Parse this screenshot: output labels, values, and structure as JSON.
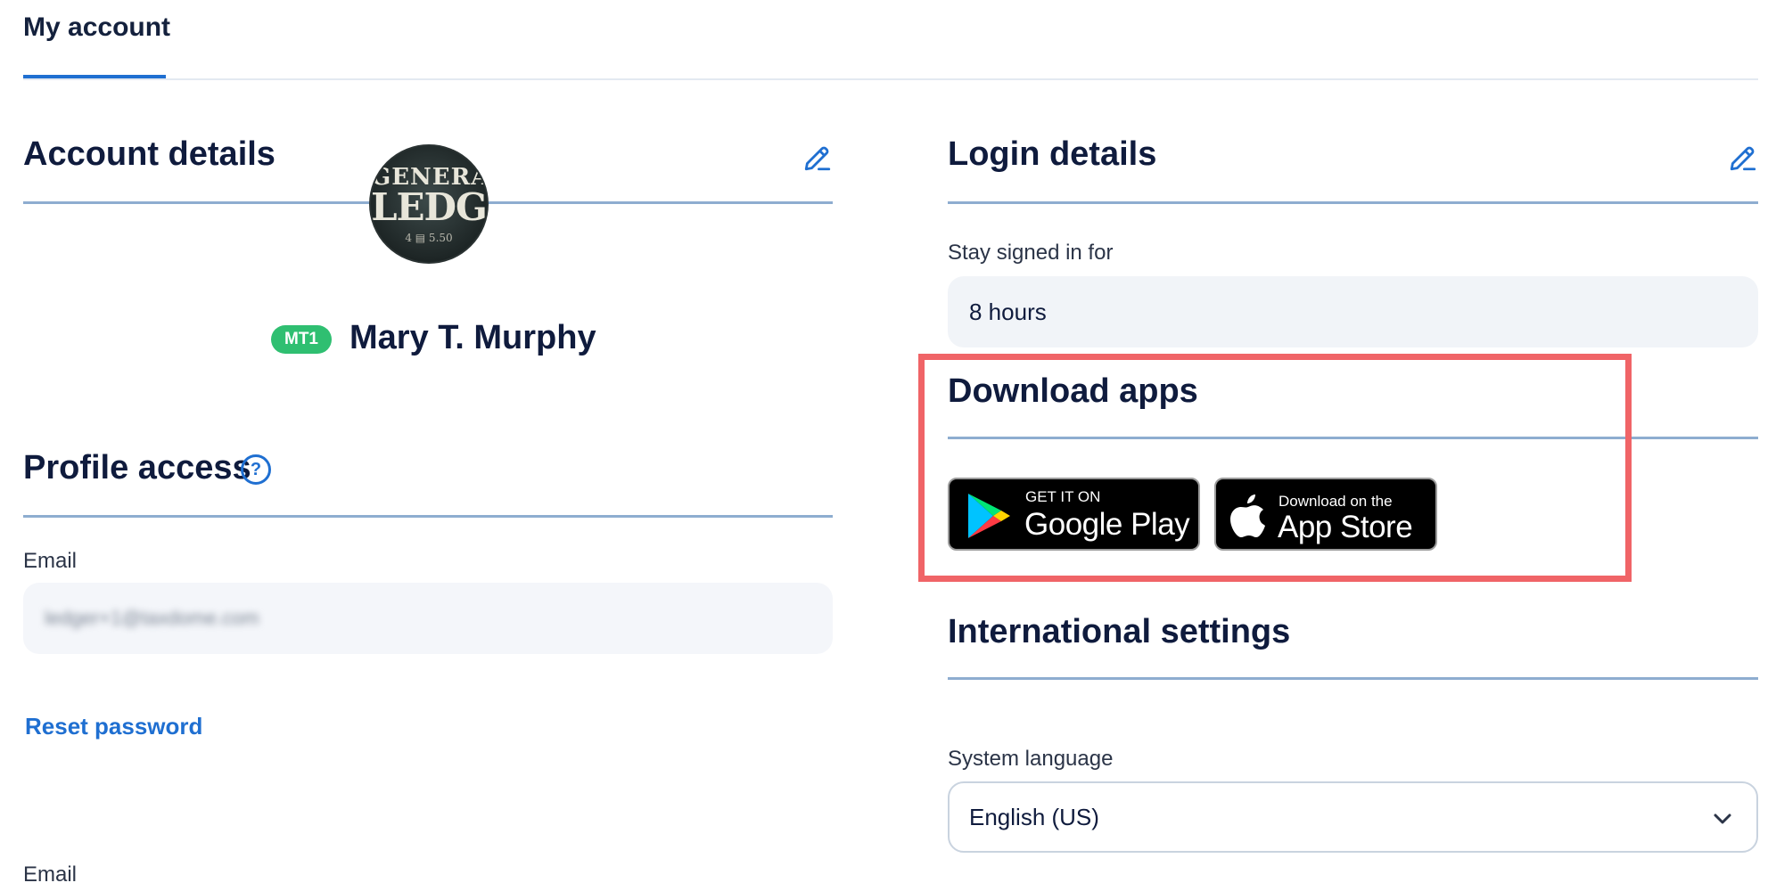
{
  "tabs": [
    {
      "label": "My account",
      "active": true
    }
  ],
  "account_details": {
    "title": "Account details",
    "avatar": {
      "line1": "GENERAL",
      "line2": "LEDGER",
      "line3": "4 ▤ 5.50"
    },
    "badge": "MT1",
    "name": "Mary T. Murphy"
  },
  "profile_access": {
    "title": "Profile access",
    "email_label": "Email",
    "email_value": "ledger+1@taxdome.com",
    "reset_password": "Reset password",
    "email_label_2": "Email"
  },
  "login_details": {
    "title": "Login details",
    "stay_signed_label": "Stay signed in for",
    "stay_signed_value": "8 hours"
  },
  "download_apps": {
    "title": "Download apps",
    "google_play": {
      "small": "GET IT ON",
      "big": "Google Play"
    },
    "app_store": {
      "small": "Download on the",
      "big": "App Store"
    }
  },
  "international": {
    "title": "International settings",
    "language_label": "System language",
    "language_value": "English (US)"
  },
  "colors": {
    "accent": "#1f6fd1",
    "badge": "#2fbf71",
    "highlight": "#f06467",
    "rule": "#8eadd0"
  },
  "icons": [
    "pencil-icon",
    "question-icon",
    "play-triangle-icon",
    "apple-icon",
    "chevron-down-icon"
  ]
}
